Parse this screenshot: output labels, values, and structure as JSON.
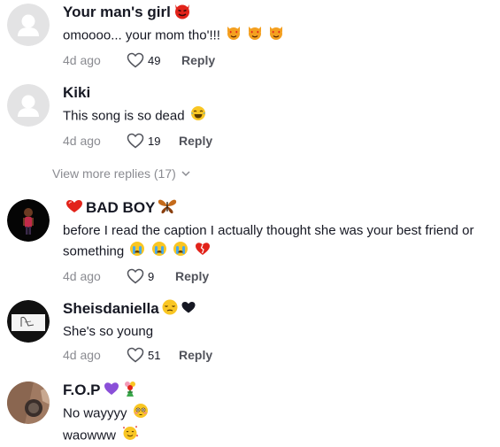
{
  "comments": [
    {
      "username": "Your man's girl",
      "text": "omoooo... your mom tho'!!!",
      "time": "4d ago",
      "likes": "49",
      "reply_label": "Reply",
      "avatar": "default-avatar"
    },
    {
      "username": "Kiki",
      "text": "This song is so dead",
      "time": "4d ago",
      "likes": "19",
      "reply_label": "Reply",
      "avatar": "default-avatar"
    },
    {
      "username": "BAD BOY",
      "text_line1": "before I read the caption I actually thought she was your best friend or",
      "text_line2": "something",
      "time": "4d ago",
      "likes": "9",
      "reply_label": "Reply",
      "avatar": "photo-avatar"
    },
    {
      "username": "Sheisdaniella",
      "text": "She's so young",
      "time": "4d ago",
      "likes": "51",
      "reply_label": "Reply",
      "avatar": "sketch-avatar"
    },
    {
      "username": "F.O.P",
      "text_line1": "No wayyyy",
      "text_line2": "waowww",
      "avatar": "photo-avatar"
    }
  ],
  "view_more": "View more replies (17)",
  "colors": {
    "username": "#161823",
    "meta": "#8a8b91",
    "reply": "#51535b",
    "default_avatar_bg": "#e3e3e4"
  }
}
